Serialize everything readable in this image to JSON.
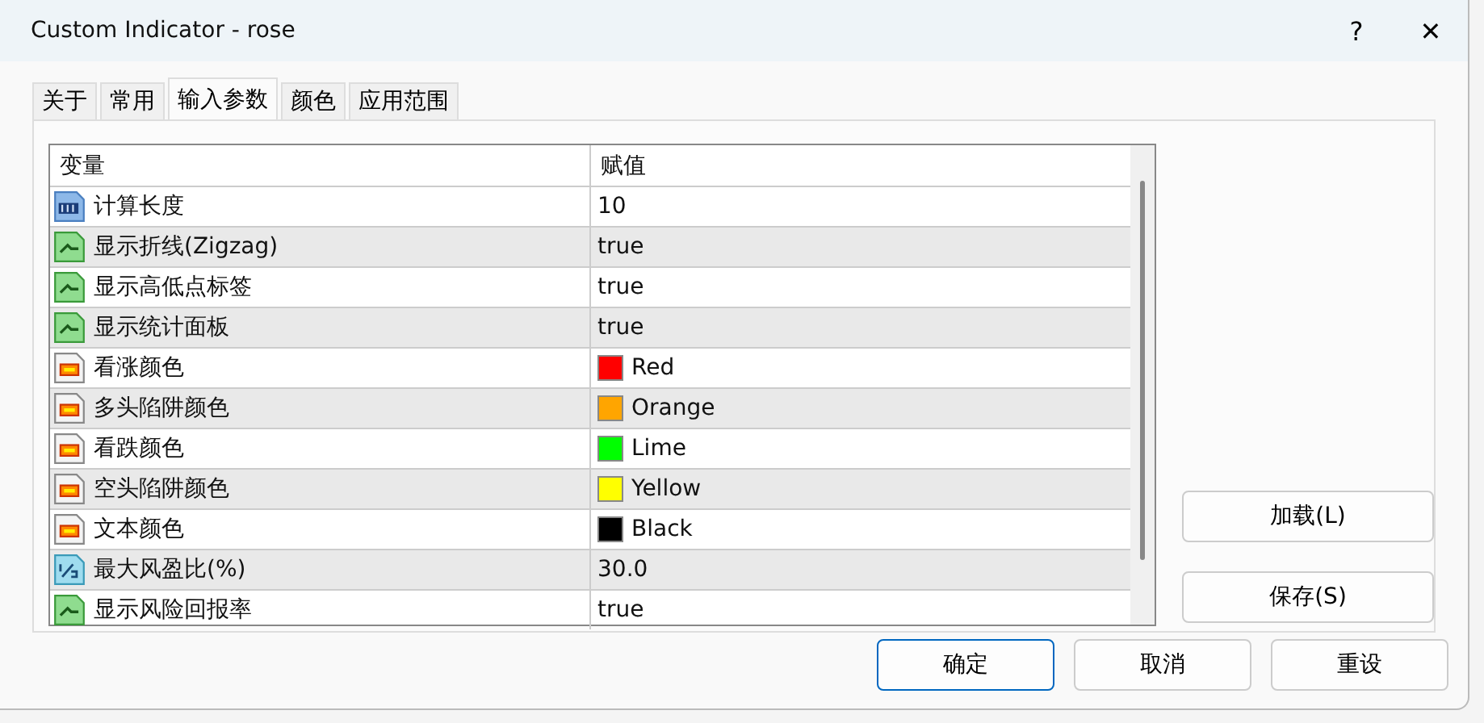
{
  "window": {
    "title": "Custom Indicator - rose",
    "help": "?",
    "close": "✕"
  },
  "tabs": [
    {
      "label": "关于",
      "selected": false
    },
    {
      "label": "常用",
      "selected": false
    },
    {
      "label": "输入参数",
      "selected": true
    },
    {
      "label": "颜色",
      "selected": false
    },
    {
      "label": "应用范围",
      "selected": false
    }
  ],
  "table": {
    "columns": [
      "变量",
      "赋值"
    ],
    "rows": [
      {
        "kind": "int",
        "name": "计算长度",
        "value": "10"
      },
      {
        "kind": "bool",
        "name": "显示折线(Zigzag)",
        "value": "true"
      },
      {
        "kind": "bool",
        "name": "显示高低点标签",
        "value": "true"
      },
      {
        "kind": "bool",
        "name": "显示统计面板",
        "value": "true"
      },
      {
        "kind": "color",
        "name": "看涨颜色",
        "value": "Red",
        "color": "#ff0000"
      },
      {
        "kind": "color",
        "name": "多头陷阱颜色",
        "value": "Orange",
        "color": "#ffa500"
      },
      {
        "kind": "color",
        "name": "看跌颜色",
        "value": "Lime",
        "color": "#00ff00"
      },
      {
        "kind": "color",
        "name": "空头陷阱颜色",
        "value": "Yellow",
        "color": "#ffff00"
      },
      {
        "kind": "color",
        "name": "文本颜色",
        "value": "Black",
        "color": "#000000"
      },
      {
        "kind": "double",
        "name": "最大风盈比(%)",
        "value": "30.0"
      },
      {
        "kind": "bool",
        "name": "显示风险回报率",
        "value": "true"
      }
    ]
  },
  "side_buttons": [
    "加载(L)",
    "保存(S)"
  ],
  "buttons": [
    {
      "label": "确定",
      "default": true
    },
    {
      "label": "取消",
      "default": false
    },
    {
      "label": "重设",
      "default": false
    }
  ]
}
